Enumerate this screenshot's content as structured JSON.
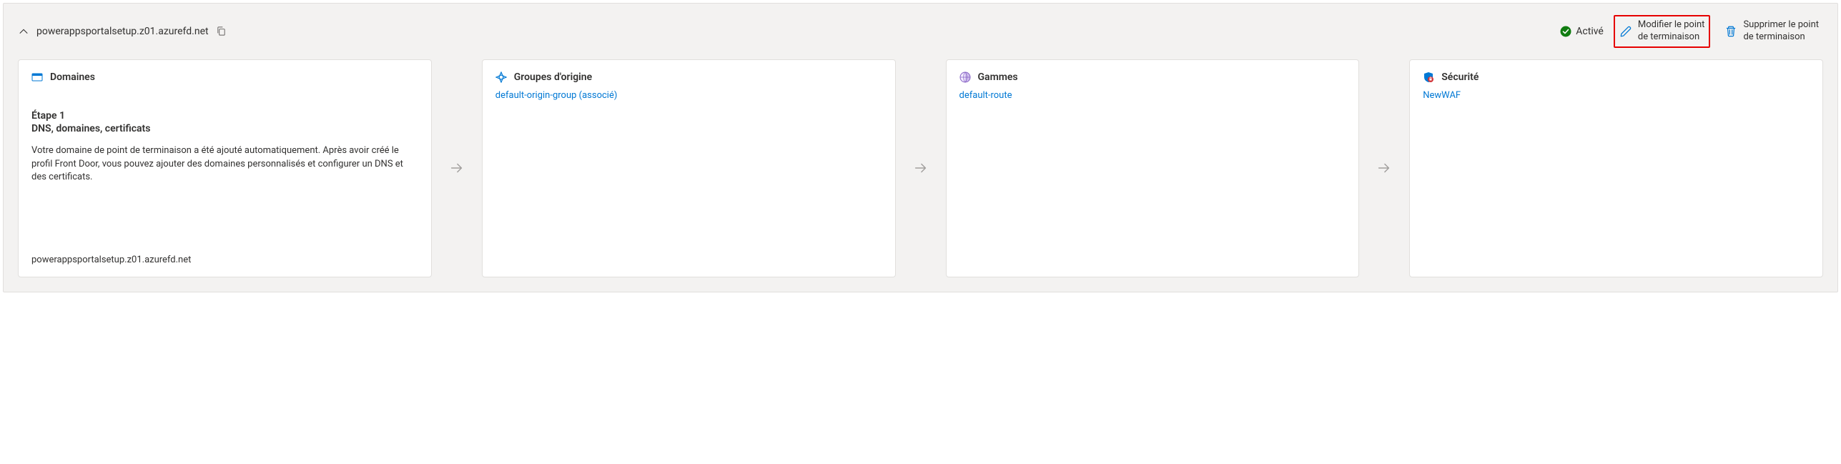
{
  "header": {
    "title": "powerappsportalsetup.z01.azurefd.net",
    "status_label": "Activé",
    "edit_button_line1": "Modifier le point",
    "edit_button_line2": "de terminaison",
    "delete_button_line1": "Supprimer le point",
    "delete_button_line2": "de terminaison"
  },
  "cards": {
    "domains": {
      "title": "Domaines",
      "step_label": "Étape 1",
      "step_title": "DNS, domaines, certificats",
      "step_description": "Votre domaine de point de terminaison a été ajouté automatiquement. Après avoir créé le profil Front Door, vous pouvez ajouter des domaines personnalisés et configurer un DNS et des certificats.",
      "footer": "powerappsportalsetup.z01.azurefd.net"
    },
    "origin_groups": {
      "title": "Groupes d'origine",
      "link": "default-origin-group (associé)"
    },
    "routes": {
      "title": "Gammes",
      "link": "default-route"
    },
    "security": {
      "title": "Sécurité",
      "link": "NewWAF"
    }
  }
}
